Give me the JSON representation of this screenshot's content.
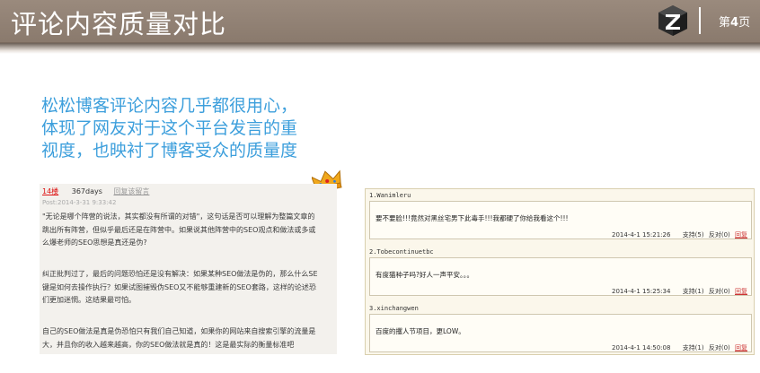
{
  "header": {
    "title": "评论内容质量对比",
    "page_prefix": "第",
    "page_number": "4",
    "page_suffix": "页",
    "logo_icon": "z-cube-logo-icon"
  },
  "headline": {
    "lines": [
      "松松博客评论内容几乎都很用心，",
      "体现了网友对于这个平台发言的重",
      "视度，也映衬了博客受众的质量度"
    ],
    "decoration_icon": "crown-icon"
  },
  "left_comment": {
    "floor": "14楼",
    "user": "367days",
    "reply_label": "回复该留言",
    "post_time": "Post:2014-3-31 9:33:42",
    "paragraphs": [
      [
        "\"无论是哪个阵营的说法，其实都没有所谓的对错\"，这句话是否可以理解为整篇文章的",
        "跳出所有阵营，但似乎最后还是在阵营中。如果说其他阵营中的SEO观点和做法或多或",
        "么爆老师的SEO思想是真还是伪?"
      ],
      [
        "纠正批判过了，最后的问题恐怕还是没有解决：如果某种SEO做法是伪的，那么什么SE",
        "键是如何去操作执行？如果试图摧毁伪SEO又不能够重建新的SEO套路，这样的论述恐",
        "们更加迷惘。这结果最可怕。"
      ],
      [
        "自己的SEO做法是真是伪恐怕只有我们自己知道，如果你的网站来自搜索引擎的流量是",
        "大，并且你的收入越来越高，你的SEO做法就是真的！这是最实际的衡量标准吧"
      ]
    ]
  },
  "right_comments": [
    {
      "name": "1.Wanimleru",
      "text": "要不要脸!!!竟然对黑丝宅男下此毒手!!!我都硬了你给我看这个!!!",
      "time": "2014-4-1 15:21:26",
      "support": "支持(5)",
      "oppose": "反对(0)",
      "reply": "回复"
    },
    {
      "name": "2.Tobecontinuetbc",
      "text": "有度猫种子吗?好人一声平安。。。",
      "time": "2014-4-1 15:25:34",
      "support": "支持(1)",
      "oppose": "反对(0)",
      "reply": "回复"
    },
    {
      "name": "3.xinchangwen",
      "text": "百度的攫人节项目，更LOW。",
      "time": "2014-4-1 14:50:08",
      "support": "支持(1)",
      "oppose": "反对(0)",
      "reply": "回复"
    }
  ],
  "colors": {
    "header_bg": "#8f8074",
    "headline": "#3d9fdc",
    "floor_link": "#dd1111",
    "reply_link": "#cc3333"
  }
}
